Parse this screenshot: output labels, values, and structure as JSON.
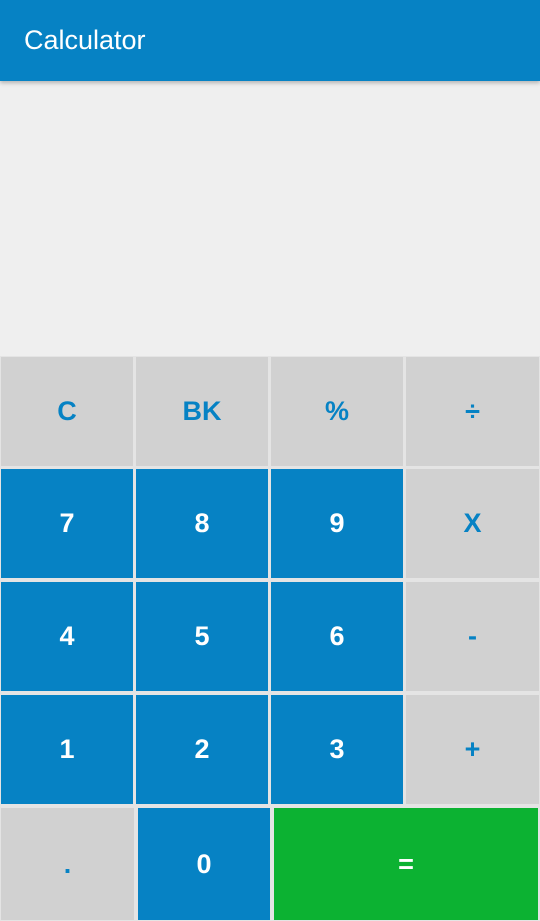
{
  "app_bar": {
    "title": "Calculator"
  },
  "display": {
    "expression": ""
  },
  "keys": {
    "clear": "C",
    "backspace": "BK",
    "percent": "%",
    "divide": "÷",
    "seven": "7",
    "eight": "8",
    "nine": "9",
    "multiply": "X",
    "four": "4",
    "five": "5",
    "six": "6",
    "subtract": "-",
    "one": "1",
    "two": "2",
    "three": "3",
    "add": "+",
    "decimal": ".",
    "zero": "0",
    "equals": "="
  },
  "colors": {
    "primary": "#0682c4",
    "operator_bg": "#d1d1d1",
    "equals_bg": "#0cb232",
    "display_bg": "#efefef"
  }
}
